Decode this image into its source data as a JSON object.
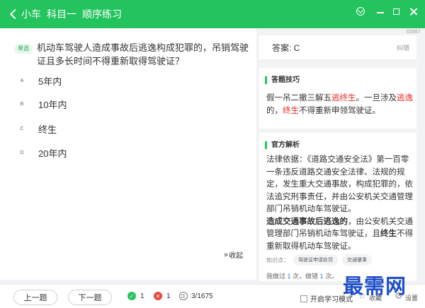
{
  "titlebar": {
    "app": "小车",
    "subject": "科目一",
    "mode": "顺序练习"
  },
  "question": {
    "type": "单选",
    "text": "机动车驾驶人造成事故后逃逸构成犯罪的，吊销驾驶证且多长时间不得重新取得驾驶证？",
    "options": [
      {
        "letter": "A",
        "text": "5年内"
      },
      {
        "letter": "B",
        "text": "10年内"
      },
      {
        "letter": "C",
        "text": "终生"
      },
      {
        "letter": "D",
        "text": "20年内"
      }
    ],
    "id": "02567"
  },
  "collapse_label": "收起",
  "answer": {
    "text": "答案: C",
    "error_btn": "纠错"
  },
  "tips": {
    "heading": "答题技巧",
    "p1": "假一吊二撤三解五",
    "p2": "逃终生",
    "p3": "。一旦涉及",
    "p4": "逃逸",
    "p5": "的，",
    "p6": "终生",
    "p7": "不得重新申领驾驶证。"
  },
  "explanation": {
    "heading": "官方解析",
    "para1": "法律依据：《道路交通安全法》第一百零一条违反道路交通安全法律、法规的规定，发生重大交通事故，构成犯罪的，依法追究刑事责任，并由公安机关交通管理部门吊销机动车驾驶证。",
    "para2_bold": "造成交通事故后逃逸的",
    "para2_rest": "，由公安机关交通管理部门吊销机动车驾驶证，且",
    "para2_bold2": "终生",
    "para2_end": "不得重新取得机动车驾驶证。",
    "kp_label": "知识点：",
    "kp_tags": [
      "驾驶证申请处罚",
      "交通肇事"
    ],
    "hist_1": "我做过 ",
    "hist_count": "1",
    "hist_2": " 次，做错 ",
    "hist_wrong": "1",
    "hist_3": " 次。"
  },
  "watermark": "最需网",
  "bottom": {
    "prev_label": "上一题",
    "next_label": "下一题",
    "correct_count": "1",
    "wrong_count": "1",
    "progress": "3/1675",
    "toggle_label": "开启学习模式",
    "fav_label": "收藏",
    "settings_label": "设置"
  },
  "colors": {
    "brand": "#23c45e",
    "error": "#e82a2a"
  },
  "icons": [
    "back-arrow-icon",
    "menu-icon",
    "minimize-icon",
    "maximize-icon",
    "close-icon",
    "collapse-icon",
    "check-icon",
    "x-icon",
    "list-icon",
    "star-icon",
    "gear-icon"
  ]
}
